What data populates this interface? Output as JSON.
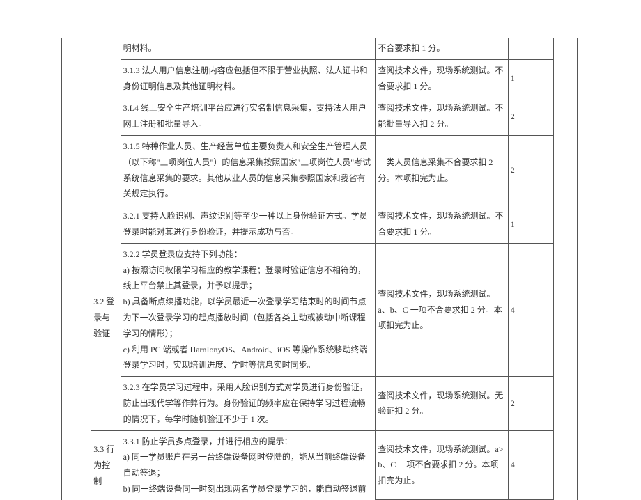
{
  "rows": [
    {
      "content": "明材料。",
      "criteria": "不合要求扣 1 分。",
      "score": "",
      "c_no_top": true,
      "d_no_top": true,
      "e_no_top": true
    },
    {
      "content": "3.1.3 法人用户信息注册内容应包括但不限于营业执照、法人证书和身份证明信息及其他证明材料。",
      "criteria": "查阅技术文件，现场系统测试。不合要求扣 1 分。",
      "score": "1"
    },
    {
      "content": "3.L4 线上安全生产培训平台应进行实名制信息采集，支持法人用户网上注册和批量导入。",
      "criteria": "查阅技术文件，现场系统测试。不能批量导入扣 2 分。",
      "score": "2"
    },
    {
      "content": "3.1.5 特种作业人员、生产经营单位主要负责人和安全生产管理人员（以下称\"三项岗位人员\"）的信息采集按照国家\"三项岗位人员\"考试系统信息采集的要求。其他从业人员的信息采集参照国家和我省有关规定执行。",
      "criteria": "一类人员信息采集不合要求扣 2 分。本项扣完为止。",
      "score": "2"
    },
    {
      "section": "3.2 登录与验证",
      "section_rowspan": 3,
      "content": "3.2.1 支持人脸识别、声纹识别等至少一种以上身份验证方式。学员登录时能对其进行身份验证，并提示成功与否。",
      "criteria": "查阅技术文件，现场系统测试。不合要求扣 1 分。",
      "score": "1"
    },
    {
      "content": "3.2.2 学员登录应支持下列功能：\na) 按照访问权限学习相应的教学课程；登录时验证信息不相符的，线上平台禁止其登录，并予以提示；\nb) 具备断点续播功能，以学员最近一次登录学习结束时的时间节点为下一次登录学习的起点播放时间（包括各类主动或被动中断课程学习的情形）；\nc) 利用 PC 端或者 HarnIonyOS、Android、iOS 等操作系统移动终端登录学习时，实现培训进度、学时等信息实时同步。",
      "criteria": "查阅技术文件，现场系统测试。a、b、C 一项不合要求扣 2 分。本项扣完为止。",
      "score": "4"
    },
    {
      "content": "3.2.3 在学员学习过程中，采用人脸识别方式对学员进行身份验证，防止出现代学等作弊行为。身份验证的频率应在保持学习过程流畅的情况下，每学时随机验证不少于 1 次。",
      "criteria": "查阅技术文件，现场系统测试。无验证扣 2 分。",
      "score": "2"
    },
    {
      "section": "3.3 行为控制",
      "section_rowspan": 1,
      "content": "3.3.1 防止学员多点登录，并进行相应的提示：\na) 同一学员账户在另一台终端设备网时登陆的，能从当前终端设备自动签退；\nb) 同一终端设备同一时刻出现两名学员登录学习的，能自动签退前",
      "criteria": "查阅技术文件，现场系统测试。a>b、C 一项不合要求扣 2 分。本项扣完为止。",
      "score": "4",
      "b_no_bottom": true,
      "c_no_bottom": true
    }
  ]
}
